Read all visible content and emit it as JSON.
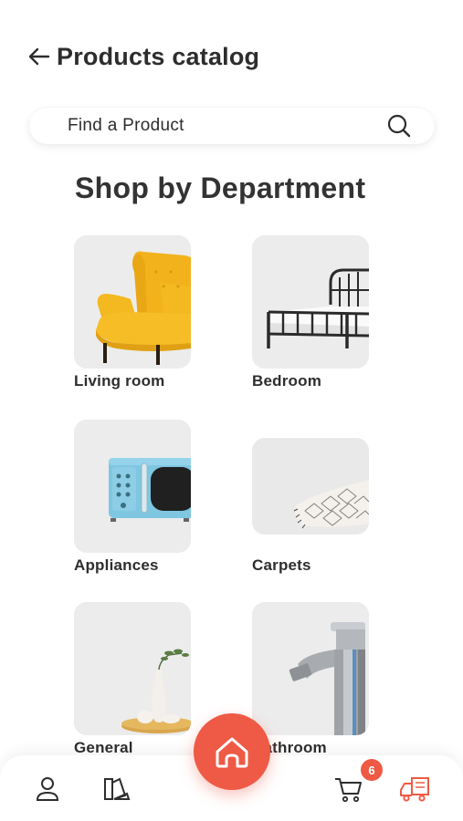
{
  "header": {
    "title": "Products catalog"
  },
  "search": {
    "placeholder": "Find a Product"
  },
  "section": {
    "title": "Shop by Department"
  },
  "departments": [
    {
      "label": "Living room"
    },
    {
      "label": "Bedroom"
    },
    {
      "label": "Appliances"
    },
    {
      "label": "Carpets"
    },
    {
      "label": "General"
    },
    {
      "label": "Bathroom"
    }
  ],
  "nav": {
    "cart_count": "6",
    "accent": "#ee5a45"
  },
  "icons": [
    "back-arrow-icon",
    "search-icon",
    "armchair-image",
    "bed-image",
    "microwave-image",
    "carpet-image",
    "vase-image",
    "faucet-image",
    "user-icon",
    "swatches-icon",
    "home-icon",
    "cart-icon",
    "delivery-truck-icon"
  ]
}
